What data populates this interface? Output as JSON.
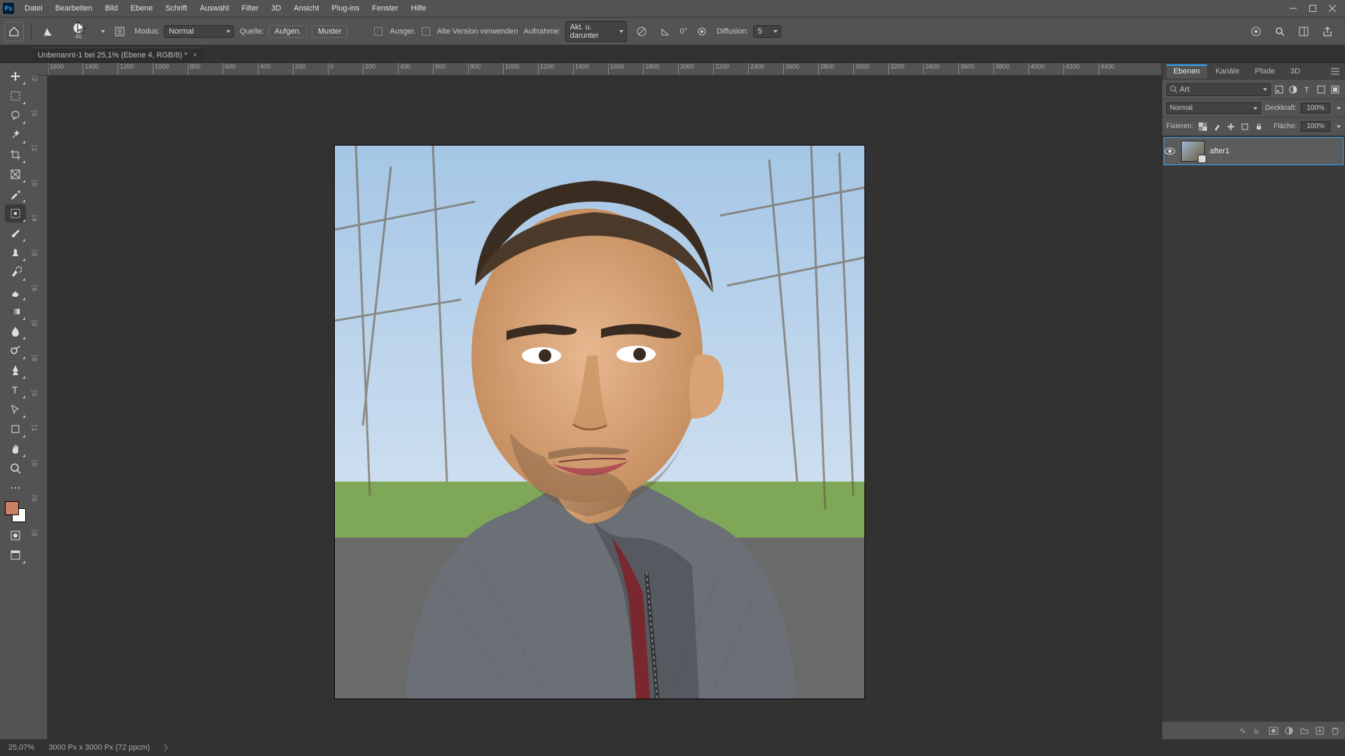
{
  "menu": {
    "items": [
      "Datei",
      "Bearbeiten",
      "Bild",
      "Ebene",
      "Schrift",
      "Auswahl",
      "Filter",
      "3D",
      "Ansicht",
      "Plug-ins",
      "Fenster",
      "Hilfe"
    ]
  },
  "options": {
    "brush_size": "46",
    "modus_label": "Modus:",
    "modus_value": "Normal",
    "quelle_label": "Quelle:",
    "aufgen_btn": "Aufgen.",
    "muster_btn": "Muster",
    "ausger_label": "Ausger.",
    "alte_label": "Alte Version verwenden",
    "aufnahme_label": "Aufnahme:",
    "aufnahme_value": "Akt. u. darunter",
    "angle_value": "0°",
    "diffusion_label": "Diffusion:",
    "diffusion_value": "5"
  },
  "tab": {
    "title": "Unbenannt-1 bei 25,1% (Ebene 4, RGB/8) *"
  },
  "ruler_h": [
    "1600",
    "1400",
    "1200",
    "1000",
    "800",
    "600",
    "400",
    "200",
    "0",
    "200",
    "400",
    "600",
    "800",
    "1000",
    "1200",
    "1400",
    "1600",
    "1800",
    "2000",
    "2200",
    "2400",
    "2600",
    "2800",
    "3000",
    "3200",
    "3400",
    "3600",
    "3800",
    "4000",
    "4200",
    "4400"
  ],
  "ruler_v": [
    "2",
    "0",
    "2",
    "0",
    "4",
    "0",
    "6",
    "0",
    "8",
    "0",
    "1",
    "0",
    "0",
    "0"
  ],
  "panels": {
    "tabs": [
      "Ebenen",
      "Kanäle",
      "Pfade",
      "3D"
    ],
    "search_placeholder": "Art",
    "blend_mode": "Normal",
    "opacity_label": "Deckkraft:",
    "opacity_value": "100%",
    "lock_label": "Fixieren:",
    "fill_label": "Fläche:",
    "fill_value": "100%",
    "layer_name": "after1"
  },
  "status": {
    "zoom": "25,07%",
    "doc": "3000 Px x 3000 Px (72 ppcm)"
  },
  "icons": {
    "search": "search-icon",
    "cloud": "cloud-icon"
  }
}
